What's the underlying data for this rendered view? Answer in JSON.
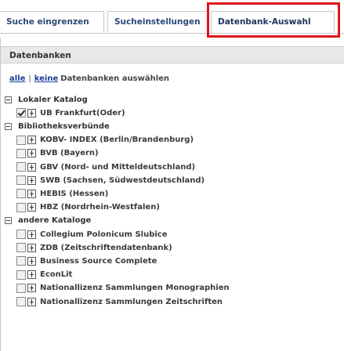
{
  "tabs": [
    {
      "label": "Suche eingrenzen"
    },
    {
      "label": "Sucheinstellungen"
    },
    {
      "label": "Datenbank-Auswahl"
    }
  ],
  "panel": {
    "title": "Datenbanken",
    "select_all": "alle",
    "select_none": "keine",
    "select_text": "Datenbanken auswählen"
  },
  "groups": [
    {
      "label": "Lokaler Katalog",
      "items": [
        {
          "label": "UB Frankfurt(Oder)",
          "checked": true
        }
      ]
    },
    {
      "label": "Bibliotheksverbünde",
      "items": [
        {
          "label": "KOBV- INDEX (Berlin/Brandenburg)",
          "checked": false
        },
        {
          "label": "BVB (Bayern)",
          "checked": false
        },
        {
          "label": "GBV (Nord- und Mitteldeutschland)",
          "checked": false
        },
        {
          "label": "SWB (Sachsen, Südwestdeutschland)",
          "checked": false
        },
        {
          "label": "HEBIS (Hessen)",
          "checked": false
        },
        {
          "label": "HBZ (Nordrhein-Westfalen)",
          "checked": false
        }
      ]
    },
    {
      "label": "andere Kataloge",
      "items": [
        {
          "label": "Collegium Polonicum Slubice",
          "checked": false
        },
        {
          "label": "ZDB (Zeitschriftendatenbank)",
          "checked": false
        },
        {
          "label": "Business Source Complete",
          "checked": false
        },
        {
          "label": "EconLit",
          "checked": false
        },
        {
          "label": "Nationallizenz Sammlungen Monographien",
          "checked": false
        },
        {
          "label": "Nationallizenz Sammlungen Zeitschriften",
          "checked": false
        }
      ]
    }
  ],
  "colors": {
    "highlight": "#e0141e",
    "link": "#1a3d99"
  }
}
